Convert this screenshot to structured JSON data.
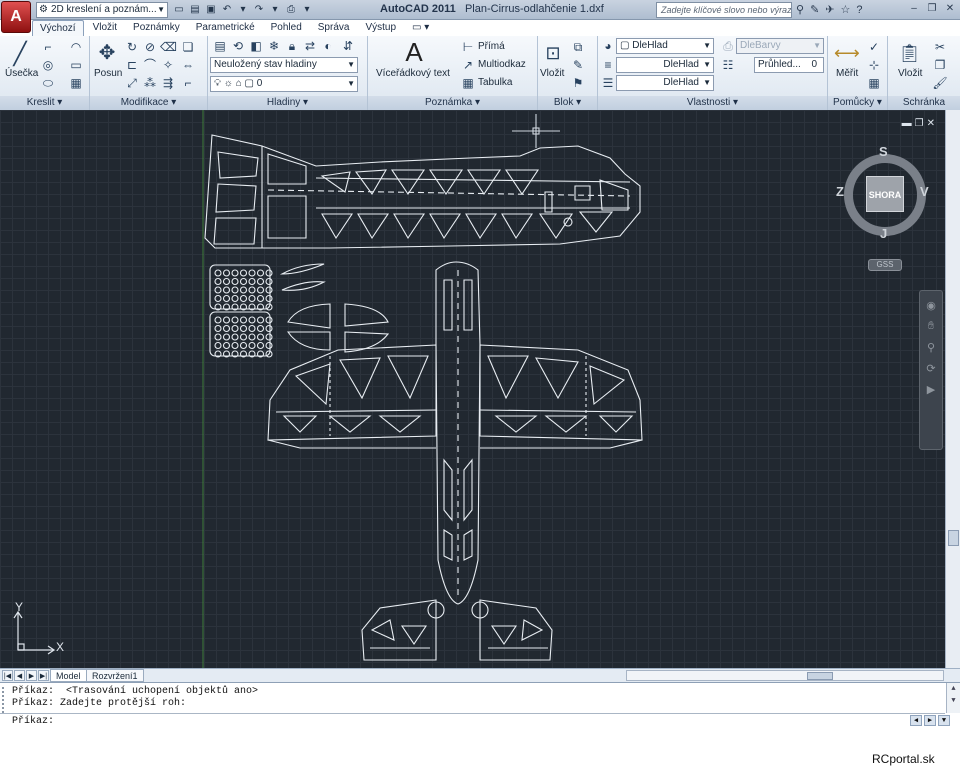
{
  "app": {
    "logo": "A",
    "title": "AutoCAD 2011",
    "filename": "Plan-Cirrus-odlahčenie 1.dxf"
  },
  "workspace": {
    "label": "2D kreslení a poznám..."
  },
  "search": {
    "placeholder": "Zadejte klíčové slovo nebo výraz."
  },
  "tabs": [
    "Výchozí",
    "Vložit",
    "Poznámky",
    "Parametrické",
    "Pohled",
    "Správa",
    "Výstup"
  ],
  "active_tab": "Výchozí",
  "panels": {
    "kreslit": {
      "title": "Kreslit",
      "big_label": "Úsečka"
    },
    "modifikace": {
      "title": "Modifikace",
      "big_label": "Posun"
    },
    "hladiny": {
      "title": "Hladiny",
      "state": "Neuložený stav hladiny",
      "layer": "0"
    },
    "poznamka": {
      "title": "Poznámka",
      "big_label": "Víceřádkový text",
      "items": [
        "Přímá",
        "Multiodkaz",
        "Tabulka"
      ]
    },
    "blok": {
      "title": "Blok",
      "big_label": "Vložit"
    },
    "vlastnosti": {
      "title": "Vlastnosti",
      "color": "DleHlad",
      "linetype": "DleHlad",
      "lineweight": "DleHlad",
      "plotstyle": "DleBarvy",
      "transparency_label": "Průhled...",
      "transparency_value": "0"
    },
    "pomucky": {
      "title": "Pomůcky",
      "big_label": "Měřit"
    },
    "schranka": {
      "title": "Schránka",
      "big_label": "Vložit"
    }
  },
  "viewcube": {
    "face": "SHORA",
    "north": "S",
    "south": "J",
    "east": "V",
    "west": "Z",
    "wcs": "GSS"
  },
  "ucs": {
    "x": "X",
    "y": "Y"
  },
  "layout_tabs": [
    "Model",
    "Rozvržení1"
  ],
  "command": {
    "history": [
      "Příkaz:  <Trasování uchopení objektů ano>",
      "Příkaz: Zadejte protější roh:"
    ],
    "prompt": "Příkaz:"
  },
  "watermark": "RCportal.sk",
  "colors": {
    "canvas": "#212830",
    "drawing": "#e8edf2",
    "accent": "#c0262c"
  }
}
